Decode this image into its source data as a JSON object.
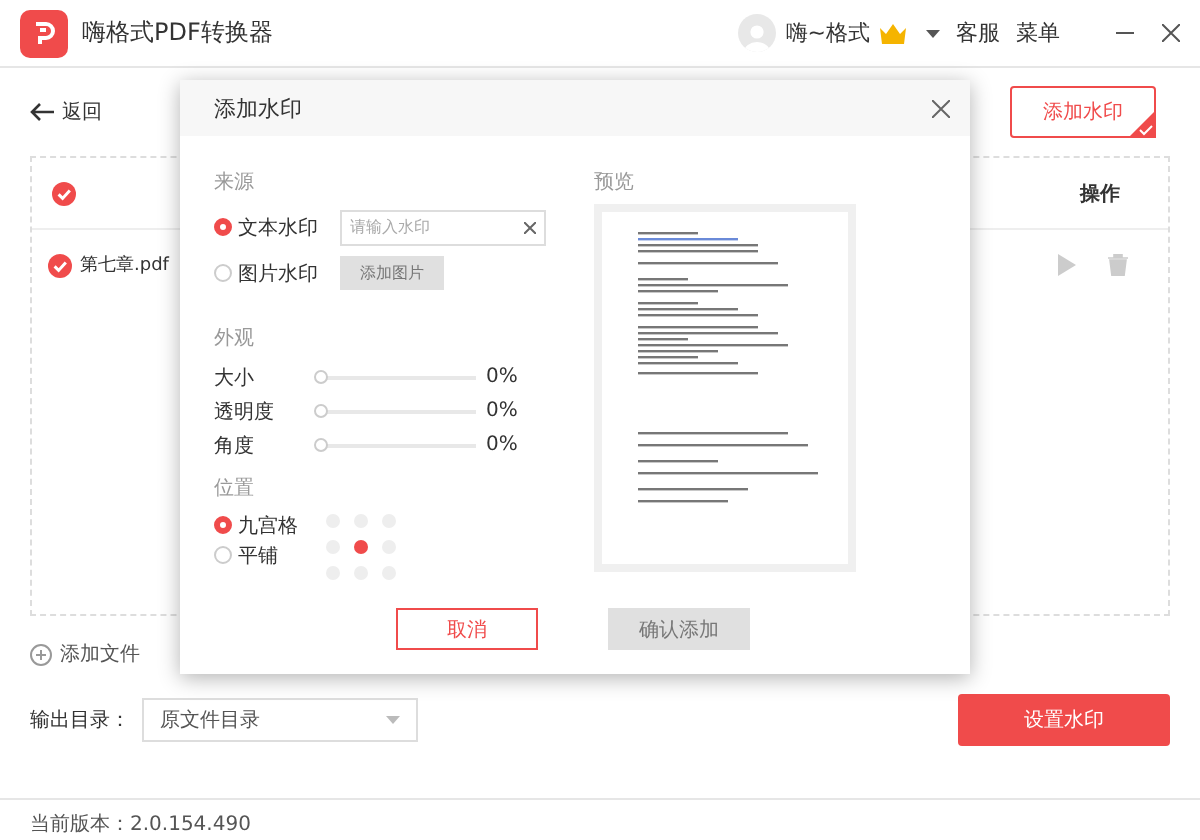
{
  "app": {
    "title": "嗨格式PDF转换器",
    "user": "嗨~格式",
    "menu_items": [
      "客服",
      "菜单"
    ]
  },
  "toolbar": {
    "back": "返回",
    "watermark_button": "添加水印"
  },
  "table": {
    "header": {
      "checked": true,
      "actions": "操作"
    },
    "rows": [
      {
        "name": "第七章.pdf",
        "checked": true
      }
    ]
  },
  "add_file": "添加文件",
  "output": {
    "label": "输出目录：",
    "value": "原文件目录"
  },
  "primary_button": "设置水印",
  "version": "当前版本：2.0.154.490",
  "dialog": {
    "title": "添加水印",
    "source": {
      "label": "来源",
      "options": [
        {
          "kind": "text",
          "label": "文本水印",
          "selected": true,
          "placeholder": "请输入水印"
        },
        {
          "kind": "image",
          "label": "图片水印",
          "selected": false,
          "button": "添加图片",
          "disabled": true
        }
      ]
    },
    "appearance": {
      "label": "外观",
      "sliders": [
        {
          "name": "大小",
          "level": 0,
          "reading": "0%"
        },
        {
          "name": "透明度",
          "level": 0,
          "reading": "0%"
        },
        {
          "name": "角度",
          "level": 0,
          "reading": "0%"
        }
      ]
    },
    "position": {
      "label": "位置",
      "options": [
        {
          "label": "九宫格",
          "selected": true
        },
        {
          "label": "平铺",
          "selected": false
        }
      ],
      "grid": [
        {
          "selected": false
        },
        {
          "selected": false
        },
        {
          "selected": false
        },
        {
          "selected": false
        },
        {
          "selected": true
        },
        {
          "selected": false
        },
        {
          "selected": false
        },
        {
          "selected": false
        },
        {
          "selected": false
        }
      ]
    },
    "preview_label": "预览",
    "cancel": "取消",
    "confirm": {
      "label": "确认添加",
      "disabled": true
    }
  }
}
